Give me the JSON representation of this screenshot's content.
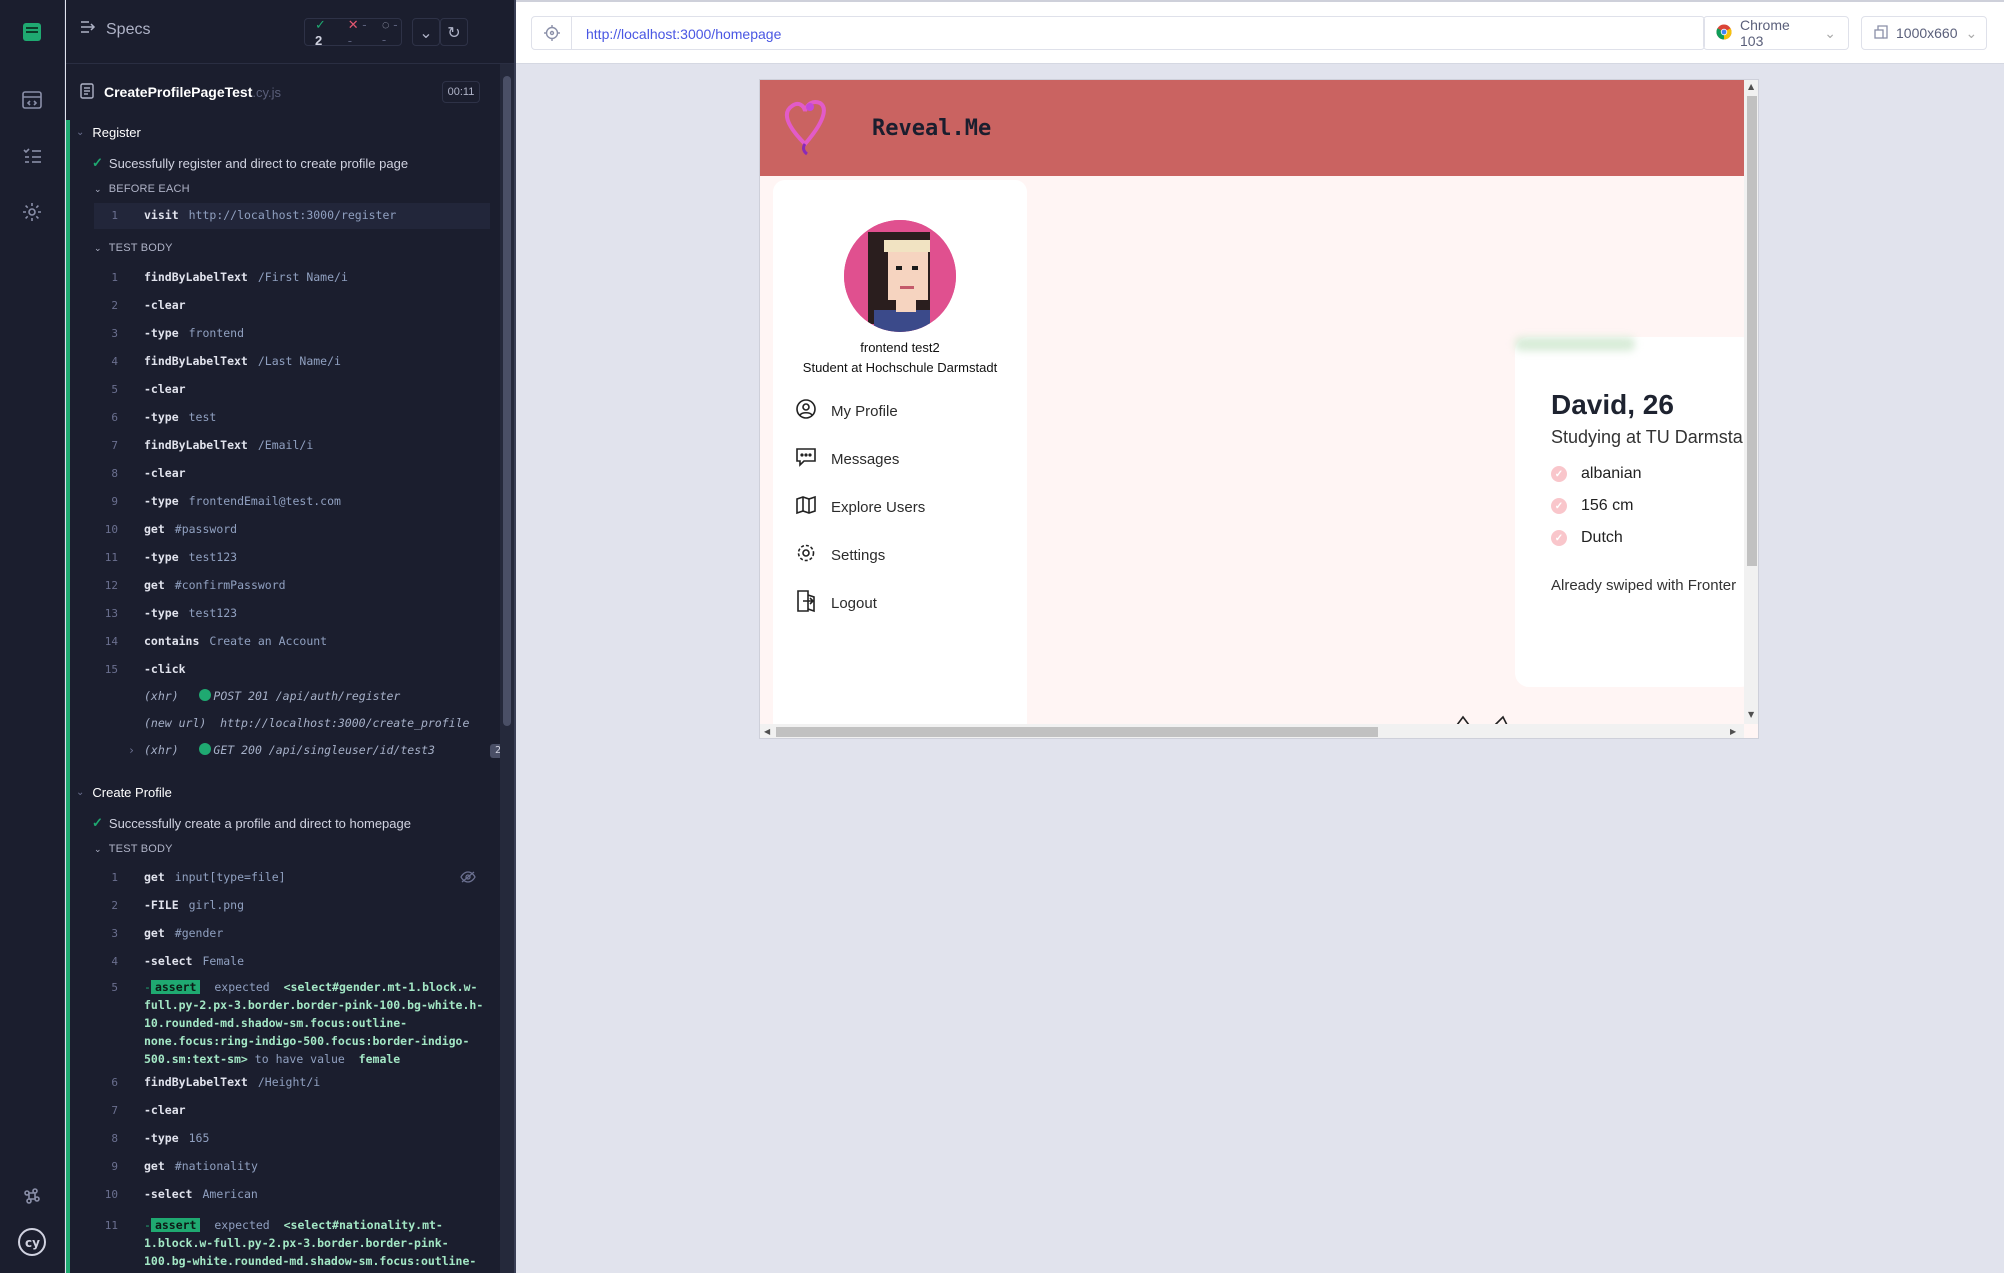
{
  "reporter": {
    "specs_label": "Specs",
    "stats": {
      "passed": "2",
      "failed": "--",
      "pending": "--"
    },
    "spec_file": {
      "name": "CreateProfilePageTest",
      "ext": ".cy.js",
      "duration": "00:11"
    },
    "suite1": {
      "title": "Register",
      "test": "Sucessfully register and direct to create profile page",
      "before_each_label": "BEFORE EACH",
      "before_each": [
        {
          "num": "1",
          "name": "visit",
          "msg": "http://localhost:3000/register"
        }
      ],
      "test_body_label": "TEST BODY",
      "commands": [
        {
          "num": "1",
          "name": "findByLabelText",
          "msg": "/First Name/i"
        },
        {
          "num": "2",
          "name": "-clear",
          "msg": ""
        },
        {
          "num": "3",
          "name": "-type",
          "msg": "frontend"
        },
        {
          "num": "4",
          "name": "findByLabelText",
          "msg": "/Last Name/i"
        },
        {
          "num": "5",
          "name": "-clear",
          "msg": ""
        },
        {
          "num": "6",
          "name": "-type",
          "msg": "test"
        },
        {
          "num": "7",
          "name": "findByLabelText",
          "msg": "/Email/i"
        },
        {
          "num": "8",
          "name": "-clear",
          "msg": ""
        },
        {
          "num": "9",
          "name": "-type",
          "msg": "frontendEmail@test.com"
        },
        {
          "num": "10",
          "name": "get",
          "msg": "#password"
        },
        {
          "num": "11",
          "name": "-type",
          "msg": "test123"
        },
        {
          "num": "12",
          "name": "get",
          "msg": "#confirmPassword"
        },
        {
          "num": "13",
          "name": "-type",
          "msg": "test123"
        },
        {
          "num": "14",
          "name": "contains",
          "msg": "Create an Account"
        },
        {
          "num": "15",
          "name": "-click",
          "msg": ""
        }
      ],
      "xhr1": {
        "tag": "(xhr)",
        "text": "POST 201 /api/auth/register"
      },
      "newurl": {
        "tag": "(new url)",
        "text": "http://localhost:3000/create_profile"
      },
      "xhr2": {
        "tag": "(xhr)",
        "text": "GET 200 /api/singleuser/id/test3",
        "count": "2"
      }
    },
    "suite2": {
      "title": "Create Profile",
      "test": "Successfully create a profile and direct to homepage",
      "test_body_label": "TEST BODY",
      "commands": [
        {
          "num": "1",
          "name": "get",
          "msg": "input[type=file]"
        },
        {
          "num": "2",
          "name": "-FILE",
          "msg": "girl.png"
        },
        {
          "num": "3",
          "name": "get",
          "msg": "#gender"
        },
        {
          "num": "4",
          "name": "-select",
          "msg": "Female"
        }
      ],
      "assert1": {
        "num": "5",
        "badge": "assert",
        "expected": "expected",
        "subject": "<select#gender.mt-1.block.w-full.py-2.px-3.border.border-pink-100.bg-white.h-10.rounded-md.shadow-sm.focus:outline-none.focus:ring-indigo-500.focus:border-indigo-500.sm:text-sm>",
        "to_have": "to have value",
        "value": "female"
      },
      "commands2": [
        {
          "num": "6",
          "name": "findByLabelText",
          "msg": "/Height/i"
        },
        {
          "num": "7",
          "name": "-clear",
          "msg": ""
        },
        {
          "num": "8",
          "name": "-type",
          "msg": "165"
        },
        {
          "num": "9",
          "name": "get",
          "msg": "#nationality"
        },
        {
          "num": "10",
          "name": "-select",
          "msg": "American"
        }
      ],
      "assert2": {
        "num": "11",
        "badge": "assert",
        "expected": "expected",
        "subject": "<select#nationality.mt-1.block.w-full.py-2.px-3.border.border-pink-100.bg-white.rounded-md.shadow-sm.focus:outline-"
      }
    }
  },
  "browser": {
    "url": "http://localhost:3000/homepage",
    "browser_name": "Chrome 103",
    "viewport": "1000x660"
  },
  "app": {
    "title": "Reveal.Me",
    "profile_name": "frontend test2",
    "profile_sub": "Student at Hochschule Darmstadt",
    "nav": [
      "My Profile",
      "Messages",
      "Explore Users",
      "Settings",
      "Logout"
    ],
    "card": {
      "name": "David, 26",
      "study": "Studying at TU Darmsta",
      "attributes": [
        "albanian",
        "156 cm",
        "Dutch"
      ],
      "swiped": "Already swiped with Fronter"
    }
  },
  "colors": {
    "accent_green": "#1fa971",
    "header_red": "#ca6361",
    "link_blue": "#4956e3"
  }
}
